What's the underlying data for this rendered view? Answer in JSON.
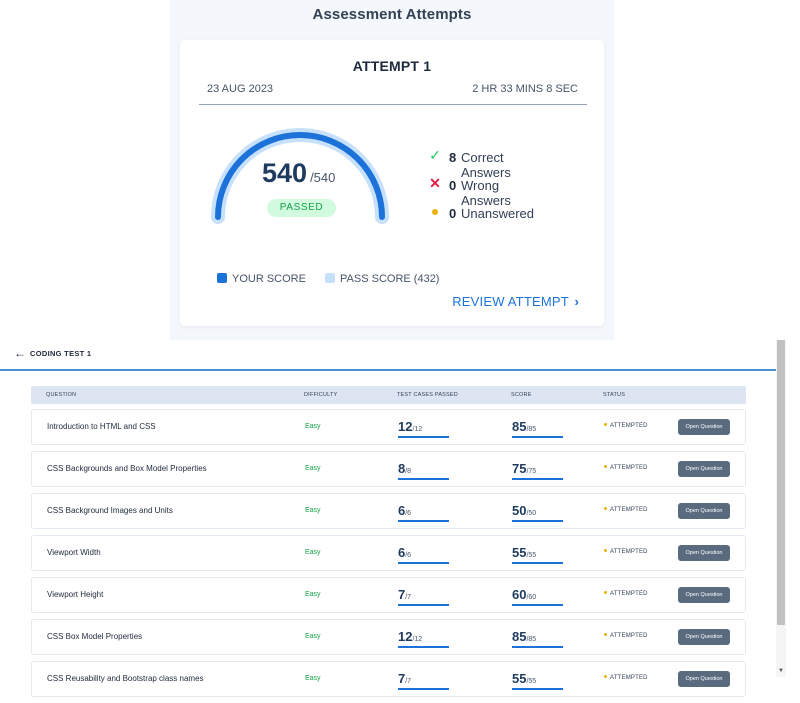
{
  "page_heading": "Assessment Attempts",
  "attempt": {
    "title": "ATTEMPT 1",
    "date": "23 AUG 2023",
    "duration": "2 HR 33 MINS 8 SEC",
    "score": "540",
    "score_max": "/540",
    "score_fraction": 1.0,
    "status": "PASSED",
    "stats": [
      {
        "icon": "check-icon",
        "count": "8",
        "label": "Correct Answers"
      },
      {
        "icon": "cross-icon",
        "count": "0",
        "label": "Wrong Answers"
      },
      {
        "icon": "dot-icon",
        "count": "0",
        "label": "Unanswered"
      }
    ],
    "legend": [
      {
        "label": "YOUR SCORE",
        "color": "#1d72d9"
      },
      {
        "label": "PASS SCORE (432)",
        "color": "#c7e0fb"
      }
    ],
    "review_label": "REVIEW ATTEMPT",
    "review_arrow": "›"
  },
  "colors": {
    "accent": "#1d72d9",
    "pass_track": "#c7e0fb",
    "success": "#16a34a",
    "danger": "#e11d48",
    "warning": "#eab308"
  },
  "coding": {
    "back_icon": "arrow-left-icon",
    "title": "CODING TEST 1",
    "headers": {
      "question": "QUESTION",
      "difficulty": "DIFFICULTY",
      "test_cases": "TEST CASES PASSED",
      "score": "SCORE",
      "status": "STATUS"
    },
    "rows": [
      {
        "question": "Introduction to HTML and CSS",
        "difficulty": "Easy",
        "tc": "12",
        "tc_total": "/12",
        "score": "85",
        "score_total": "/85",
        "status": "ATTEMPTED",
        "action": "Open Question"
      },
      {
        "question": "CSS Backgrounds and Box Model Properties",
        "difficulty": "Easy",
        "tc": "8",
        "tc_total": "/8",
        "score": "75",
        "score_total": "/75",
        "status": "ATTEMPTED",
        "action": "Open Question"
      },
      {
        "question": "CSS Background Images and Units",
        "difficulty": "Easy",
        "tc": "6",
        "tc_total": "/6",
        "score": "50",
        "score_total": "/50",
        "status": "ATTEMPTED",
        "action": "Open Question"
      },
      {
        "question": "Viewport Width",
        "difficulty": "Easy",
        "tc": "6",
        "tc_total": "/6",
        "score": "55",
        "score_total": "/55",
        "status": "ATTEMPTED",
        "action": "Open Question"
      },
      {
        "question": "Viewport Height",
        "difficulty": "Easy",
        "tc": "7",
        "tc_total": "/7",
        "score": "60",
        "score_total": "/60",
        "status": "ATTEMPTED",
        "action": "Open Question"
      },
      {
        "question": "CSS Box Model Properties",
        "difficulty": "Easy",
        "tc": "12",
        "tc_total": "/12",
        "score": "85",
        "score_total": "/85",
        "status": "ATTEMPTED",
        "action": "Open Question"
      },
      {
        "question": "CSS Reusability and Bootstrap class names",
        "difficulty": "Easy",
        "tc": "7",
        "tc_total": "/7",
        "score": "55",
        "score_total": "/55",
        "status": "ATTEMPTED",
        "action": "Open Question"
      }
    ]
  }
}
